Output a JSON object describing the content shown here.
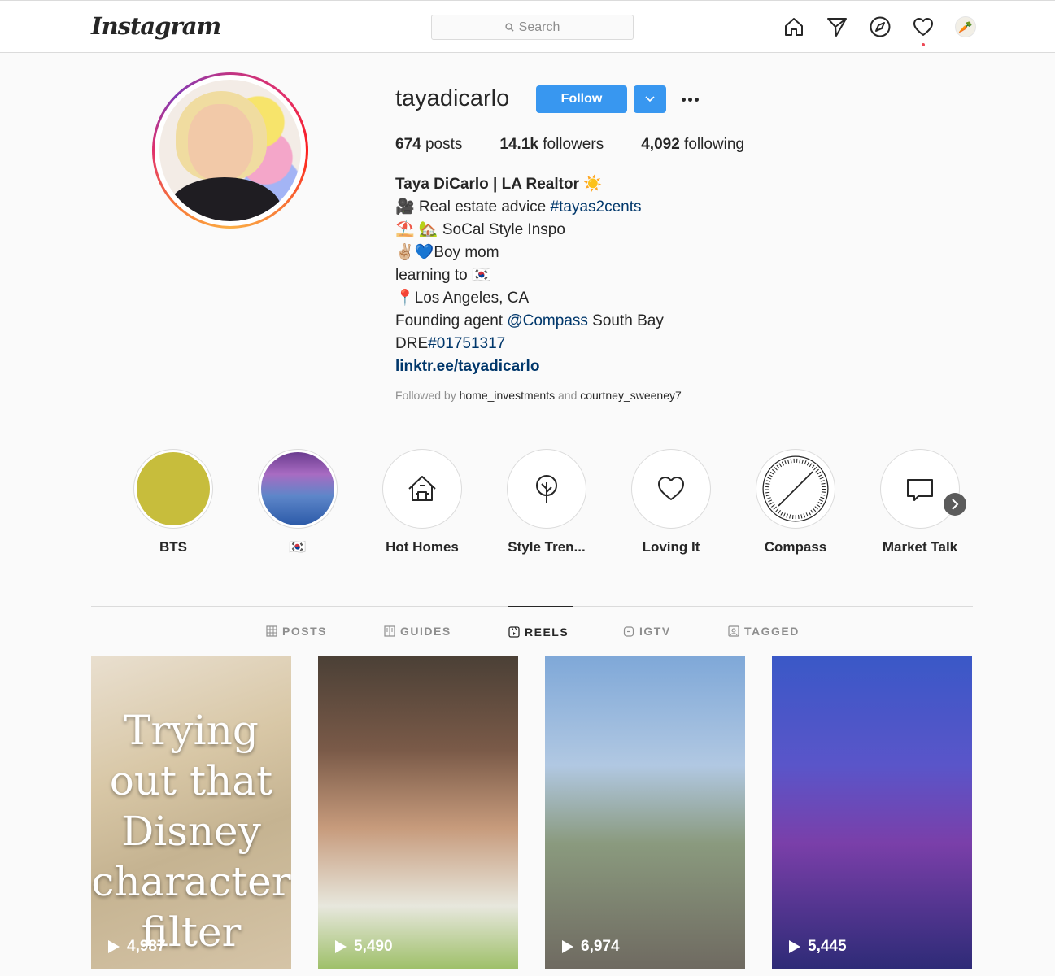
{
  "nav": {
    "logo": "Instagram",
    "search_placeholder": "Search",
    "icons": [
      "home-icon",
      "direct-icon",
      "explore-icon",
      "activity-heart-icon",
      "profile-avatar-icon"
    ]
  },
  "profile": {
    "username": "tayadicarlo",
    "follow_label": "Follow",
    "stats": {
      "posts_count": "674",
      "posts_label": "posts",
      "followers_count": "14.1k",
      "followers_label": "followers",
      "following_count": "4,092",
      "following_label": "following"
    },
    "bio": {
      "full_name": "Taya DiCarlo | LA Realtor ☀️",
      "line1_text": "🎥 Real estate advice ",
      "line1_tag": "#tayas2cents",
      "line2": "⛱️ 🏡 SoCal Style Inspo",
      "line3": "✌🏼💙Boy mom",
      "line4": "learning to 🇰🇷",
      "line5": "📍Los Angeles, CA",
      "line6_prefix": "Founding agent ",
      "line6_mention": "@Compass",
      "line6_suffix": " South Bay",
      "line7_prefix": "DRE",
      "line7_tag": "#01751317",
      "link": "linktr.ee/tayadicarlo"
    },
    "followed_by": {
      "prefix": "Followed by ",
      "user1": "home_investments",
      "conj": " and ",
      "user2": "courtney_sweeney7"
    }
  },
  "highlights": [
    {
      "label": "BTS",
      "icon": "yellow-circle"
    },
    {
      "label": "🇰🇷",
      "icon": "photo"
    },
    {
      "label": "Hot Homes",
      "icon": "house-icon"
    },
    {
      "label": "Style Tren...",
      "icon": "tree-icon"
    },
    {
      "label": "Loving It",
      "icon": "heart-icon"
    },
    {
      "label": "Compass",
      "icon": "compass-dial-icon"
    },
    {
      "label": "Market Talk",
      "icon": "speech-bubble-icon"
    }
  ],
  "tabs": [
    {
      "label": "POSTS",
      "active": false
    },
    {
      "label": "GUIDES",
      "active": false
    },
    {
      "label": "REELS",
      "active": true
    },
    {
      "label": "IGTV",
      "active": false
    },
    {
      "label": "TAGGED",
      "active": false
    }
  ],
  "reels": [
    {
      "views": "4,987",
      "overlay_text": "Trying out that Disney character filter"
    },
    {
      "views": "5,490"
    },
    {
      "views": "6,974"
    },
    {
      "views": "5,445"
    }
  ],
  "colors": {
    "accent": "#3897f0",
    "link": "#00376b",
    "muted": "#8e8e8e",
    "border": "#dbdbdb"
  }
}
